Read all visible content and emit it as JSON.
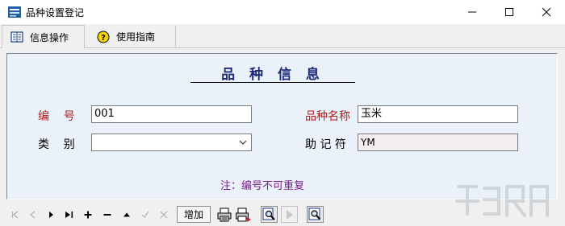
{
  "window": {
    "title": "品种设置登记"
  },
  "tabs": [
    {
      "label": "信息操作",
      "icon": "grid-book-icon",
      "active": true
    },
    {
      "label": "使用指南",
      "icon": "help-icon",
      "active": false
    }
  ],
  "form": {
    "heading": "品 种 信 息",
    "code_label": "编    号",
    "code_value": "001",
    "category_label": "类    别",
    "category_value": "",
    "name_label": "品种名称",
    "name_value": "玉米",
    "mnemonic_label": "助 记 符",
    "mnemonic_value": "YM",
    "note": "注：编号不可重复"
  },
  "toolbar": {
    "add_label": "增加",
    "nav": [
      "first-icon",
      "prev-icon",
      "next-icon",
      "last-icon",
      "plus-icon",
      "minus-icon",
      "up-icon",
      "check-icon",
      "cancel-icon"
    ],
    "tools": [
      "print-icon",
      "print-preview-icon",
      "find-icon",
      "play-icon",
      "search-icon"
    ]
  },
  "colors": {
    "label_red": "#b01c1c",
    "heading_blue": "#1e2a7a",
    "note_purple": "#7b1c8c",
    "panel_bg": "#eaf1f8"
  }
}
